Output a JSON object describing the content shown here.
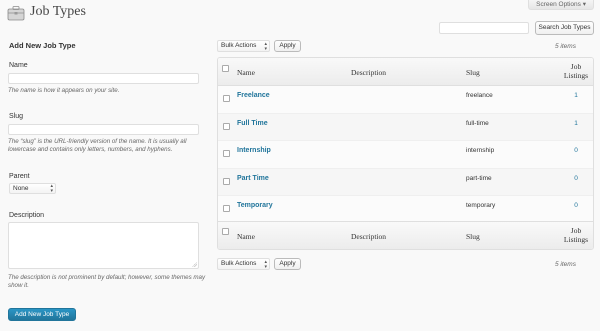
{
  "header": {
    "title": "Job Types",
    "screen_options": "Screen Options",
    "screen_options_arrow": "▾",
    "icon": "briefcase-icon"
  },
  "search": {
    "value": "",
    "placeholder": "",
    "button_label": "Search Job Types"
  },
  "form": {
    "heading": "Add New Job Type",
    "name_label": "Name",
    "name_value": "",
    "name_hint": "The name is how it appears on your site.",
    "slug_label": "Slug",
    "slug_value": "",
    "slug_hint": "The “slug” is the URL-friendly version of the name. It is usually all lowercase and contains only letters, numbers, and hyphens.",
    "parent_label": "Parent",
    "parent_selected": "None",
    "description_label": "Description",
    "description_value": "",
    "description_hint": "The description is not prominent by default; however, some themes may show it.",
    "submit_label": "Add New Job Type"
  },
  "tablenav": {
    "bulk_actions": "Bulk Actions",
    "apply_label": "Apply",
    "items_count": "5 items"
  },
  "table": {
    "columns": {
      "name": "Name",
      "description": "Description",
      "slug": "Slug",
      "listings": "Job Listings"
    },
    "rows": [
      {
        "name": "Freelance",
        "description": "",
        "slug": "freelance",
        "count": "1"
      },
      {
        "name": "Full Time",
        "description": "",
        "slug": "full-time",
        "count": "1"
      },
      {
        "name": "Internship",
        "description": "",
        "slug": "internship",
        "count": "0"
      },
      {
        "name": "Part Time",
        "description": "",
        "slug": "part-time",
        "count": "0"
      },
      {
        "name": "Temporary",
        "description": "",
        "slug": "temporary",
        "count": "0"
      }
    ]
  },
  "colors": {
    "link": "#21759b",
    "primary_button": "#21759b",
    "background": "#f9f9f9"
  }
}
